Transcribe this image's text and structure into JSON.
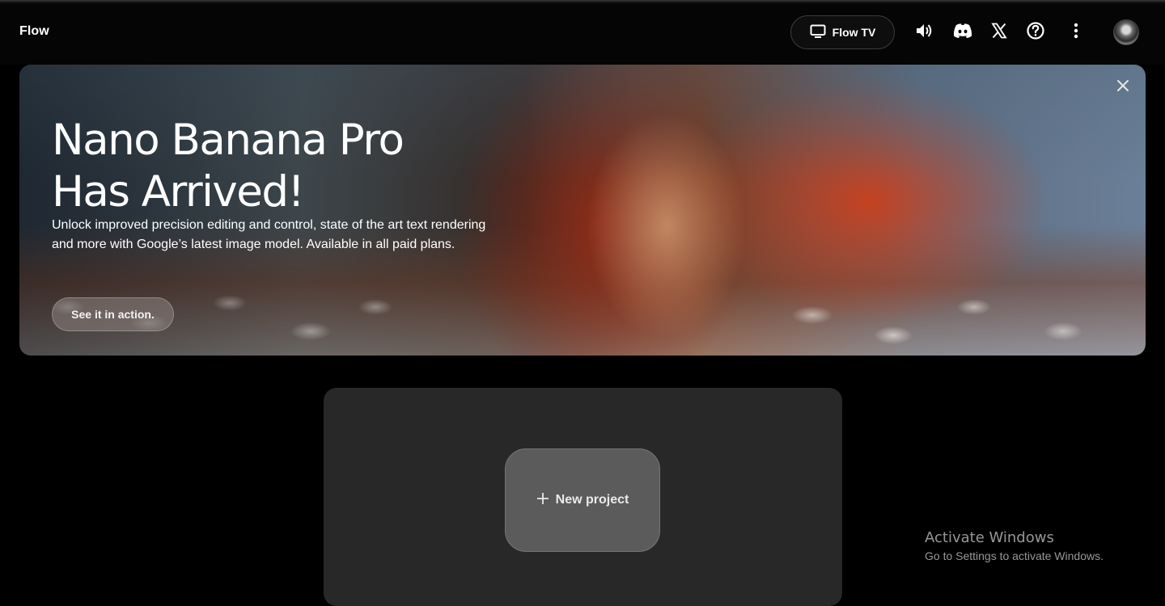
{
  "header": {
    "brand": "Flow",
    "flow_tv_label": "Flow TV",
    "icons": [
      "tv-icon",
      "volume-icon",
      "discord-icon",
      "x-icon",
      "help-icon",
      "more-vert-icon"
    ]
  },
  "banner": {
    "title_line1": "Nano Banana Pro",
    "title_line2": "Has Arrived!",
    "description": "Unlock improved precision editing and control, state of the art text rendering and more with Google’s latest image model. Available in all paid plans.",
    "cta_label": "See it in action."
  },
  "main": {
    "new_project_label": "New project"
  },
  "watermark": {
    "title": "Activate Windows",
    "subtitle": "Go to Settings to activate Windows."
  },
  "colors": {
    "background": "#000000",
    "panel": "#282828",
    "new_project_button": "#5b5b5b"
  }
}
